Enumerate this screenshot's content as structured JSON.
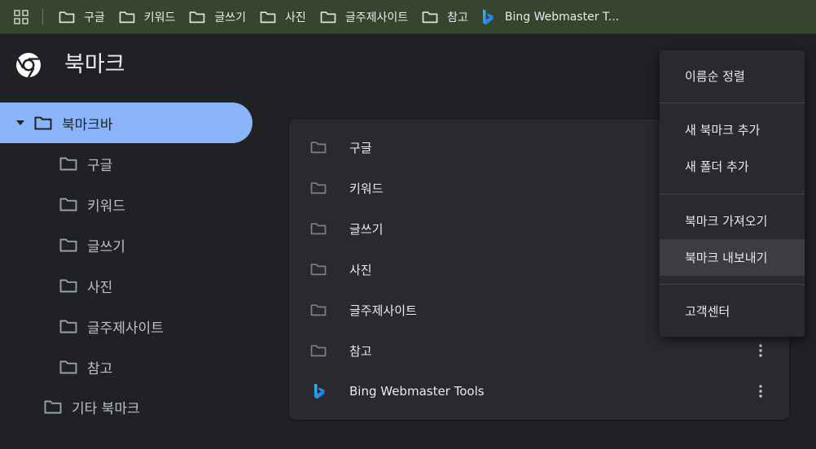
{
  "bookmarks_bar": {
    "items": [
      {
        "label": "구글",
        "icon": "folder-icon"
      },
      {
        "label": "키워드",
        "icon": "folder-icon"
      },
      {
        "label": "글쓰기",
        "icon": "folder-icon"
      },
      {
        "label": "사진",
        "icon": "folder-icon"
      },
      {
        "label": "글주제사이트",
        "icon": "folder-icon"
      },
      {
        "label": "참고",
        "icon": "folder-icon"
      },
      {
        "label": "Bing Webmaster T...",
        "icon": "bing-icon"
      }
    ]
  },
  "header": {
    "title": "북마크"
  },
  "sidebar": {
    "root": {
      "label": "북마크바",
      "expanded": true
    },
    "children": [
      {
        "label": "구글"
      },
      {
        "label": "키워드"
      },
      {
        "label": "글쓰기"
      },
      {
        "label": "사진"
      },
      {
        "label": "글주제사이트"
      },
      {
        "label": "참고"
      }
    ],
    "other": {
      "label": "기타 북마크"
    }
  },
  "list": {
    "items": [
      {
        "label": "구글",
        "type": "folder"
      },
      {
        "label": "키워드",
        "type": "folder"
      },
      {
        "label": "글쓰기",
        "type": "folder"
      },
      {
        "label": "사진",
        "type": "folder"
      },
      {
        "label": "글주제사이트",
        "type": "folder"
      },
      {
        "label": "참고",
        "type": "folder"
      },
      {
        "label": "Bing Webmaster Tools",
        "type": "bookmark"
      }
    ]
  },
  "menu": {
    "items": [
      {
        "label": "이름순 정렬"
      },
      {
        "label": "새 북마크 추가"
      },
      {
        "label": "새 폴더 추가"
      },
      {
        "label": "북마크 가져오기"
      },
      {
        "label": "북마크 내보내기",
        "hovered": true
      },
      {
        "label": "고객센터"
      }
    ]
  },
  "colors": {
    "bar_bg": "#36452e",
    "page_bg": "#202124",
    "card_bg": "#292a2d",
    "selected_bg": "#8ab4f8",
    "text": "#e8eaed",
    "icon_gray": "#9aa0a6"
  }
}
